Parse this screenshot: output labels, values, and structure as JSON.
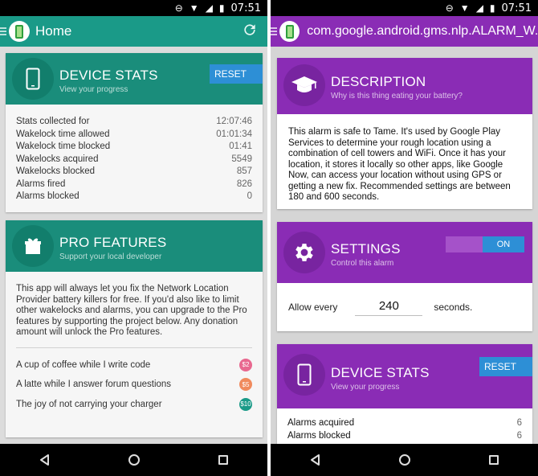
{
  "status_bar": {
    "time": "07:51"
  },
  "left": {
    "app_title": "Home",
    "device_stats": {
      "title": "DEVICE STATS",
      "subtitle": "View your progress",
      "reset_label": "RESET",
      "rows": [
        {
          "label": "Stats collected for",
          "value": "12:07:46"
        },
        {
          "label": "Wakelock time allowed",
          "value": "01:01:34"
        },
        {
          "label": "Wakelock time blocked",
          "value": "01:41"
        },
        {
          "label": "Wakelocks acquired",
          "value": "5549"
        },
        {
          "label": "Wakelocks blocked",
          "value": "857"
        },
        {
          "label": "Alarms fired",
          "value": "826"
        },
        {
          "label": "Alarms blocked",
          "value": "0"
        }
      ]
    },
    "pro_features": {
      "title": "PRO FEATURES",
      "subtitle": "Support your local developer",
      "body": "This app will always let you fix the Network Location Provider battery killers for free.  If you'd also like to limit other wakelocks and alarms, you can upgrade to the Pro features by supporting the project below.  Any donation amount will unlock the Pro features.",
      "donations": [
        {
          "label": "A cup of coffee while I write code",
          "price": "$2",
          "color": "#e8688f"
        },
        {
          "label": "A latte while I answer forum questions",
          "price": "$5",
          "color": "#f08a5d"
        },
        {
          "label": "The joy of not carrying your charger",
          "price": "$10",
          "color": "#1a9a88"
        }
      ]
    }
  },
  "right": {
    "app_title": "com.google.android.gms.nlp.ALARM_W...",
    "description": {
      "title": "DESCRIPTION",
      "subtitle": "Why is this thing eating your battery?",
      "body": "This alarm is safe to Tame. It's used by Google Play Services to determine your rough location using a combination of cell towers and WiFi. Once it has your location, it stores it locally so other apps, like Google Now, can access your location without using GPS or getting a new fix. Recommended settings are between 180 and 600 seconds."
    },
    "settings": {
      "title": "SETTINGS",
      "subtitle": "Control this alarm",
      "toggle_label": "ON",
      "allow_every_label": "Allow every",
      "interval_value": "240",
      "seconds_label": "seconds."
    },
    "device_stats": {
      "title": "DEVICE STATS",
      "subtitle": "View your progress",
      "reset_label": "RESET",
      "rows": [
        {
          "label": "Alarms acquired",
          "value": "6"
        },
        {
          "label": "Alarms blocked",
          "value": "6"
        }
      ]
    }
  },
  "colors": {
    "teal_appbar": "#1a9a88",
    "teal_card": "#1a8d7b",
    "purple": "#8a2cb5",
    "blue_button": "#2d8fd6"
  }
}
